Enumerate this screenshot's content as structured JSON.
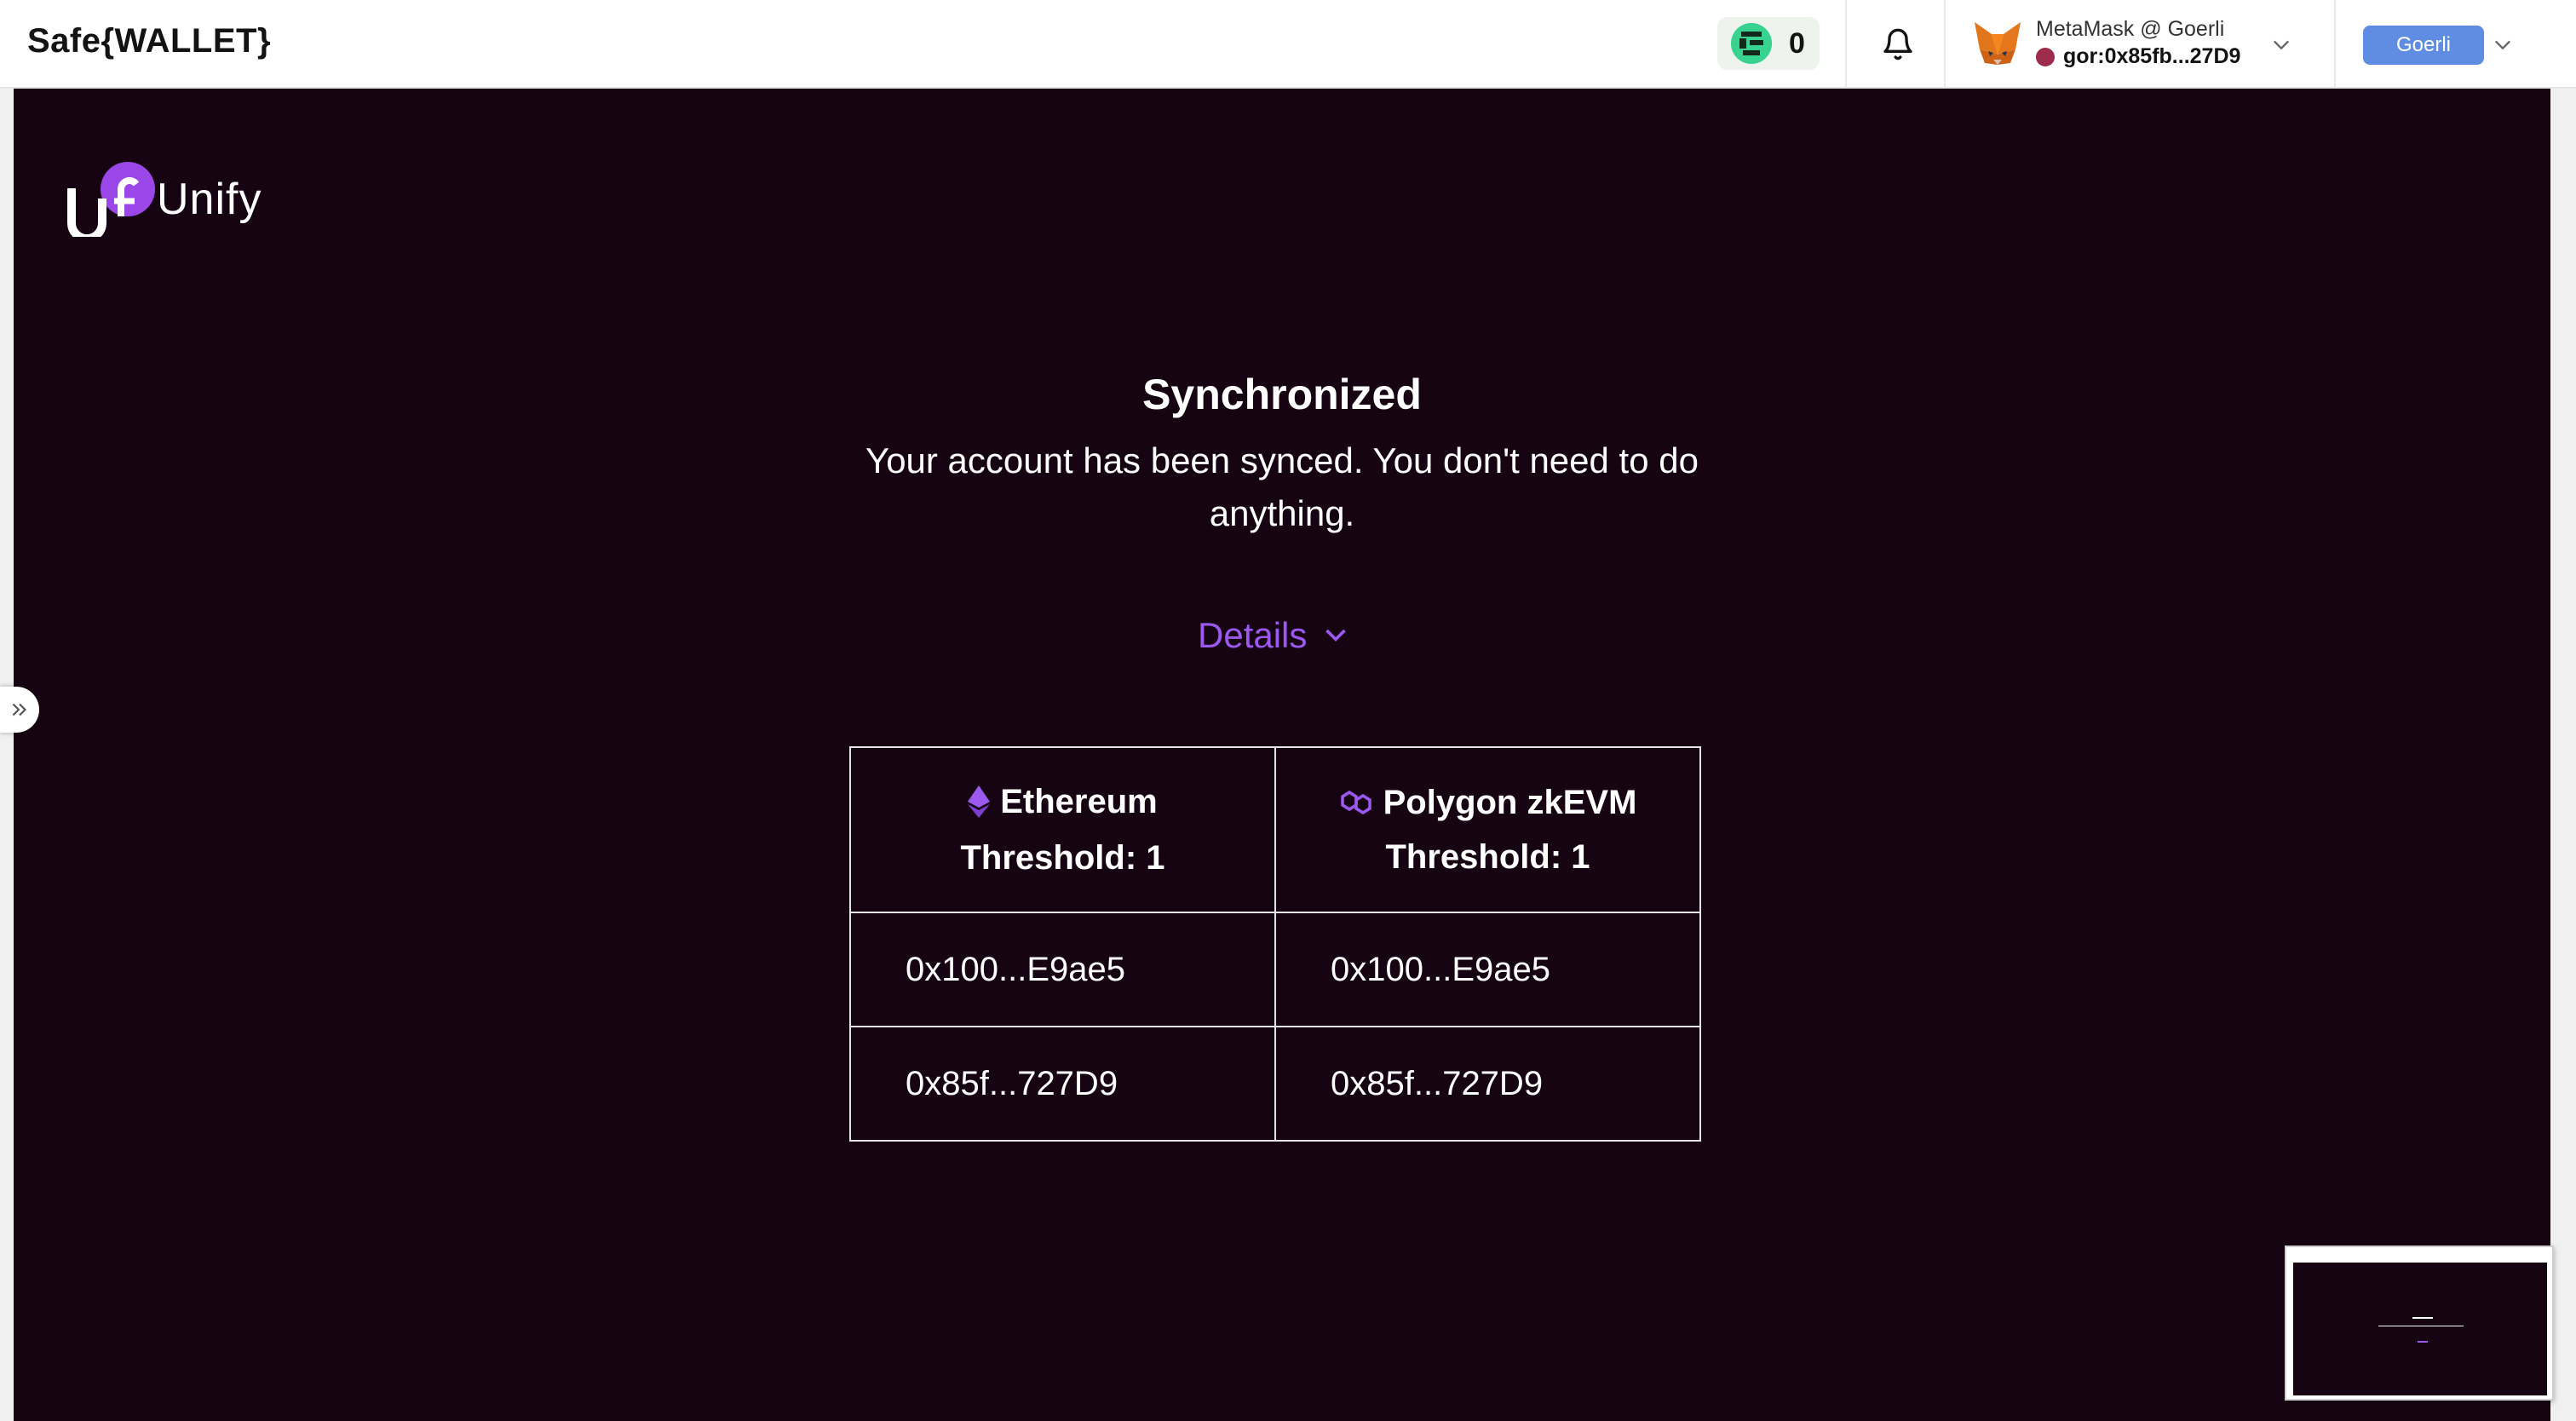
{
  "header": {
    "app_title": "Safe{WALLET}",
    "notification_count": "0",
    "account": {
      "wallet_label": "MetaMask @ Goerli",
      "address": "gor:0x85fb...27D9"
    },
    "network_button": "Goerli"
  },
  "brand": {
    "logo_text": "Unify",
    "accent_color": "#9b59f0",
    "background_color": "#170413"
  },
  "sync": {
    "title": "Synchronized",
    "message": "Your account has been synced. You don't need to do anything.",
    "details_label": "Details"
  },
  "table": {
    "columns": [
      {
        "chain": "Ethereum",
        "icon": "ethereum-icon",
        "threshold": "Threshold: 1"
      },
      {
        "chain": "Polygon zkEVM",
        "icon": "polygon-icon",
        "threshold": "Threshold: 1"
      }
    ],
    "rows": [
      [
        "0x100...E9ae5",
        "0x100...E9ae5"
      ],
      [
        "0x85f...727D9",
        "0x85f...727D9"
      ]
    ]
  },
  "icons": {
    "bell": "bell-icon",
    "fox": "metamask-fox-icon",
    "chevron": "chevron-down-icon",
    "sidebar_toggle": "double-chevron-right-icon"
  }
}
